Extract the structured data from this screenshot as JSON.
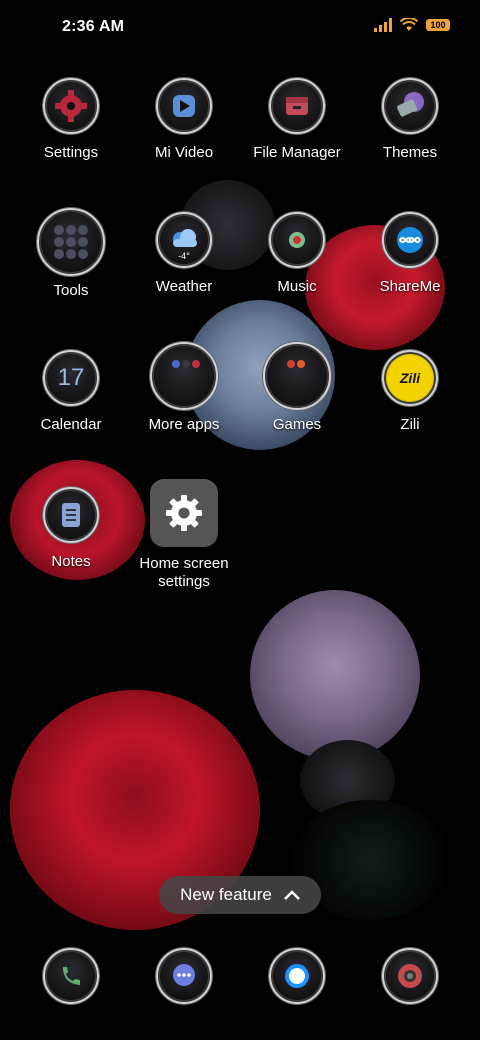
{
  "status_bar": {
    "time": "2:36 AM",
    "battery": "100"
  },
  "apps": [
    {
      "key": "settings",
      "label": "Settings",
      "icon": "gear-icon"
    },
    {
      "key": "mi_video",
      "label": "Mi Video",
      "icon": "play-icon"
    },
    {
      "key": "file_manager",
      "label": "File Manager",
      "icon": "folder-icon"
    },
    {
      "key": "themes",
      "label": "Themes",
      "icon": "brush-icon"
    },
    {
      "key": "tools",
      "label": "Tools",
      "icon": "folder-grid-icon"
    },
    {
      "key": "weather",
      "label": "Weather",
      "icon": "cloud-icon",
      "temp": "-4°"
    },
    {
      "key": "music",
      "label": "Music",
      "icon": "music-icon"
    },
    {
      "key": "shareme",
      "label": "ShareMe",
      "icon": "infinity-icon"
    },
    {
      "key": "calendar",
      "label": "Calendar",
      "icon": "calendar-icon",
      "day": "17"
    },
    {
      "key": "more_apps",
      "label": "More apps",
      "icon": "folder-grid-icon"
    },
    {
      "key": "games",
      "label": "Games",
      "icon": "folder-grid-icon"
    },
    {
      "key": "zili",
      "label": "Zili",
      "icon": "zili-logo",
      "logo_text": "Zili"
    },
    {
      "key": "notes",
      "label": "Notes",
      "icon": "notes-icon"
    },
    {
      "key": "home_settings",
      "label": "Home screen settings",
      "icon": "gear-icon"
    }
  ],
  "dock": [
    {
      "key": "phone",
      "icon": "phone-icon"
    },
    {
      "key": "messages",
      "icon": "message-icon"
    },
    {
      "key": "browser",
      "icon": "browser-icon"
    },
    {
      "key": "camera",
      "icon": "camera-icon"
    }
  ],
  "banner": {
    "label": "New feature"
  },
  "colors": {
    "rose_red": "#c0152a",
    "rose_purple": "#7a6a8c",
    "rose_blue": "#6b7f9c"
  }
}
